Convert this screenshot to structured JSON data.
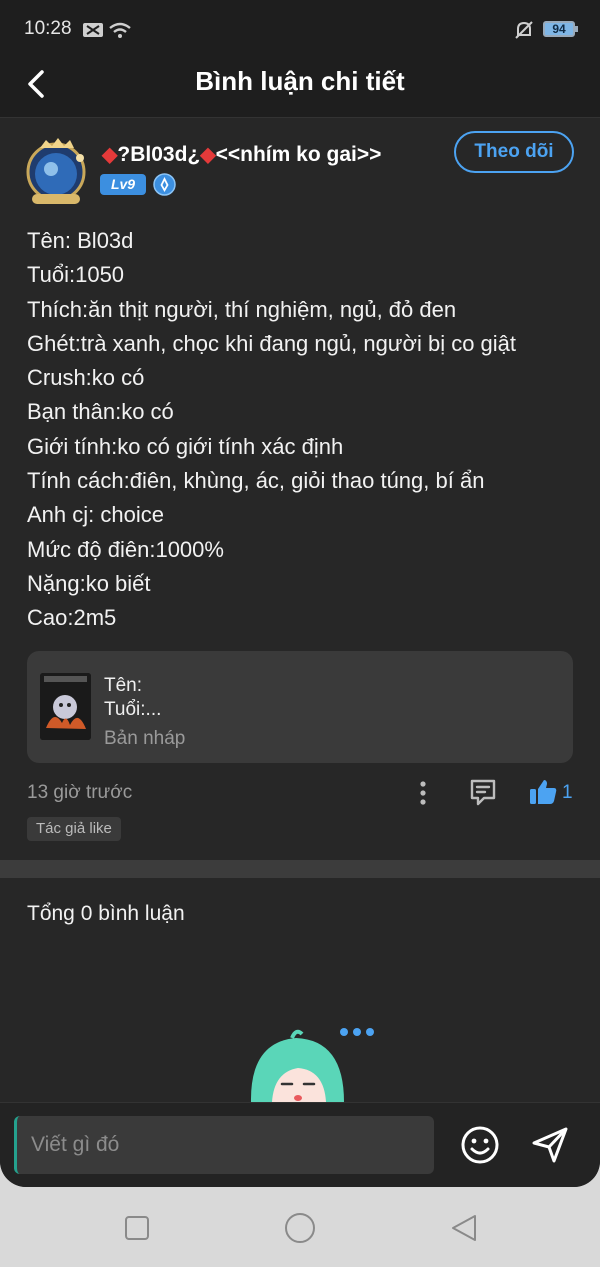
{
  "status_bar": {
    "time": "10:28",
    "battery": "94"
  },
  "header": {
    "title": "Bình luận chi tiết"
  },
  "post": {
    "username": "?Bl03d¿",
    "username_suffix": "<<nhím ko gai>>",
    "level": "Lv9",
    "follow_label": "Theo dõi",
    "lines": [
      "Tên: Bl03d",
      "Tuổi:1050",
      "Thích:ăn thịt người, thí nghiệm, ngủ, đỏ đen",
      "Ghét:trà xanh, chọc khi đang ngủ, người bị co giật",
      "Crush:ko có",
      "Bạn thân:ko có",
      "Giới tính:ko có giới tính xác định",
      "Tính cách:điên, khùng, ác, giỏi thao túng, bí ẩn",
      "Anh cj: choice",
      "Mức độ điên:1000%",
      "Nặng:ko biết",
      "Cao:2m5"
    ],
    "draft": {
      "line1": "Tên:",
      "line2": "Tuổi:...",
      "status": "Bản nháp"
    },
    "time_ago": "13 giờ trước",
    "like_count": "1",
    "author_like_tag": "Tác giả like"
  },
  "comments": {
    "total_label": "Tổng 0 bình luận"
  },
  "composer": {
    "placeholder": "Viết gì đó"
  },
  "colors": {
    "accent": "#4ca3f2",
    "background": "#272727",
    "diamond": "#e53a3a"
  }
}
